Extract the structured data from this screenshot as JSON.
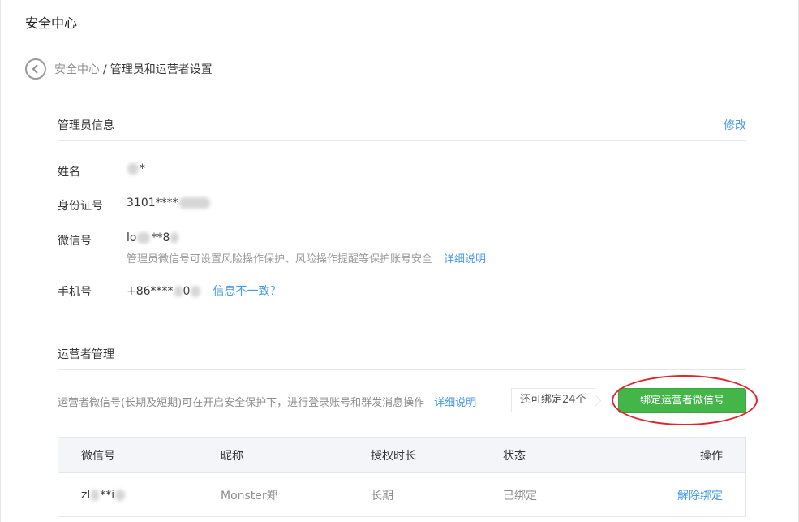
{
  "page": {
    "title": "安全中心"
  },
  "breadcrumb": {
    "parent": "安全中心",
    "separator": "/",
    "current": "管理员和运营者设置"
  },
  "admin": {
    "section_title": "管理员信息",
    "edit_label": "修改",
    "name_label": "姓名",
    "name_value": "*",
    "id_label": "身份证号",
    "id_value": "3101****",
    "wechat_label": "微信号",
    "wechat_prefix": "lo",
    "wechat_suffix": "**8",
    "wechat_hint": "管理员微信号可设置风险操作保护、风险操作提醒等保护账号安全",
    "wechat_hint_link": "详细说明",
    "phone_label": "手机号",
    "phone_value": "+86****",
    "phone_suffix": "0",
    "phone_link": "信息不一致？"
  },
  "operators": {
    "section_title": "运营者管理",
    "description": "运营者微信号(长期及短期)可在开启安全保护下，进行登录账号和群发消息操作",
    "description_link": "详细说明",
    "quota_text": "还可绑定24个",
    "bind_button": "绑定运营者微信号",
    "columns": [
      "微信号",
      "昵称",
      "授权时长",
      "状态",
      "操作"
    ],
    "rows": [
      {
        "wechat_prefix": "zl",
        "wechat_mid": "**i",
        "nickname": "Monster郑",
        "duration": "长期",
        "status": "已绑定",
        "action": "解除绑定"
      }
    ]
  },
  "colors": {
    "link": "#459ae9",
    "primary_button": "#44b549",
    "highlight_ring": "#e0242b"
  },
  "icons": {
    "back": "chevron-left-circle-icon"
  }
}
